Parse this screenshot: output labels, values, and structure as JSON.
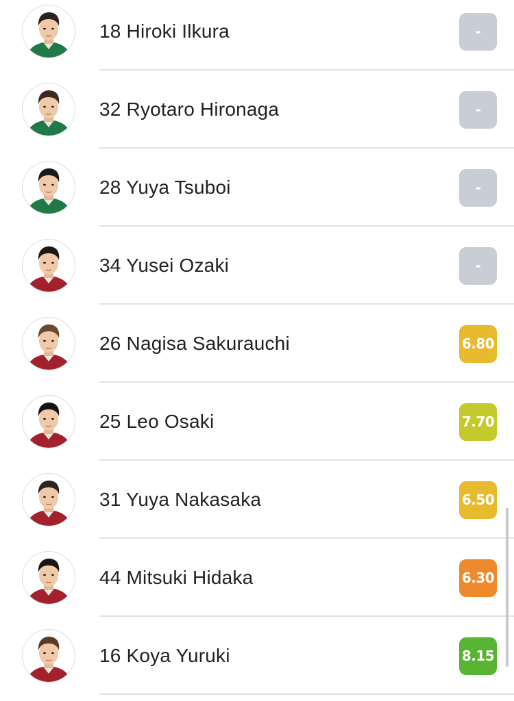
{
  "players": [
    {
      "number": "18",
      "name": "Hiroki Ilkura",
      "rating": "-",
      "rating_color": "#c9ced6",
      "kit_color": "#1f7a48",
      "hair_color": "#2a2320"
    },
    {
      "number": "32",
      "name": "Ryotaro Hironaga",
      "rating": "-",
      "rating_color": "#c9ced6",
      "kit_color": "#1f7a48",
      "hair_color": "#3a2a22"
    },
    {
      "number": "28",
      "name": "Yuya Tsuboi",
      "rating": "-",
      "rating_color": "#c9ced6",
      "kit_color": "#1f7a48",
      "hair_color": "#1e1a18"
    },
    {
      "number": "34",
      "name": "Yusei Ozaki",
      "rating": "-",
      "rating_color": "#c9ced6",
      "kit_color": "#a3212d",
      "hair_color": "#1c1816"
    },
    {
      "number": "26",
      "name": "Nagisa Sakurauchi",
      "rating": "6.80",
      "rating_color": "#e8ba2e",
      "kit_color": "#a3212d",
      "hair_color": "#6b4a2e"
    },
    {
      "number": "25",
      "name": "Leo Osaki",
      "rating": "7.70",
      "rating_color": "#c4ca2c",
      "kit_color": "#a3212d",
      "hair_color": "#141210"
    },
    {
      "number": "31",
      "name": "Yuya Nakasaka",
      "rating": "6.50",
      "rating_color": "#e8ba2e",
      "kit_color": "#a3212d",
      "hair_color": "#2e2420"
    },
    {
      "number": "44",
      "name": "Mitsuki Hidaka",
      "rating": "6.30",
      "rating_color": "#ee8a2c",
      "kit_color": "#a3212d",
      "hair_color": "#181514"
    },
    {
      "number": "16",
      "name": "Koya Yuruki",
      "rating": "8.15",
      "rating_color": "#58b534",
      "kit_color": "#a3212d",
      "hair_color": "#5a3d26"
    }
  ]
}
